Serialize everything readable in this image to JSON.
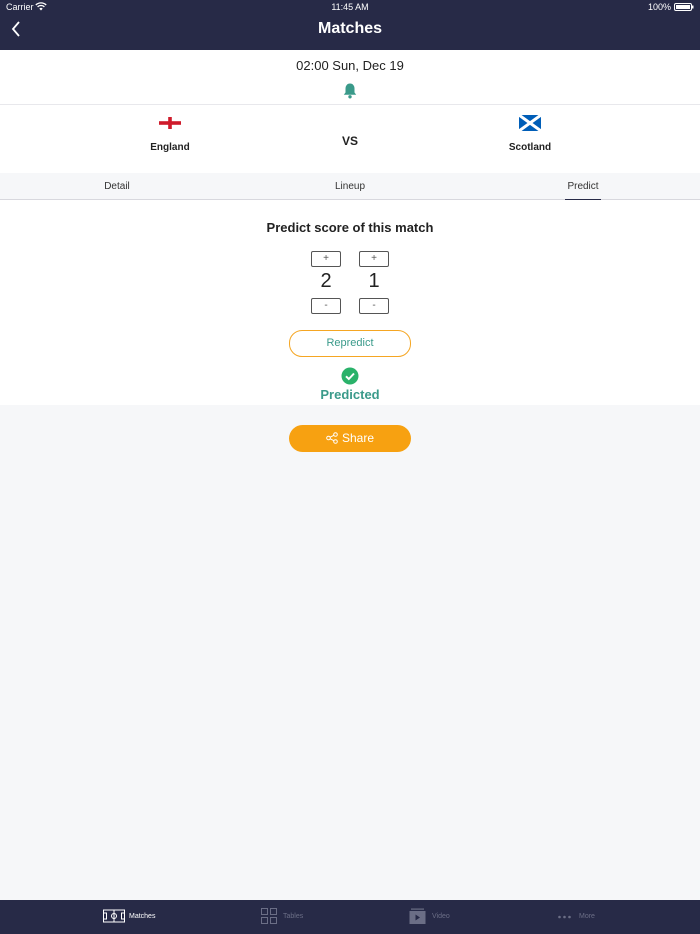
{
  "status_bar": {
    "carrier": "Carrier",
    "time": "11:45 AM",
    "battery": "100%"
  },
  "header": {
    "title": "Matches",
    "back_icon": "chevron-left-icon"
  },
  "match": {
    "datetime": "02:00 Sun, Dec 19",
    "home_team": "England",
    "away_team": "Scotland",
    "vs": "VS"
  },
  "tabs": [
    {
      "label": "Detail"
    },
    {
      "label": "Lineup"
    },
    {
      "label": "Predict",
      "active": true
    }
  ],
  "predict": {
    "title": "Predict score of this match",
    "home_score": "2",
    "away_score": "1",
    "plus": "+",
    "minus": "-",
    "repredict_label": "Repredict",
    "status": "Predicted"
  },
  "share": {
    "label": "Share"
  },
  "tab_bar": {
    "items": [
      {
        "label": "Matches",
        "icon": "pitch-icon",
        "active": true
      },
      {
        "label": "Tables",
        "icon": "grid-icon"
      },
      {
        "label": "Video",
        "icon": "video-icon"
      },
      {
        "label": "More",
        "icon": "more-icon"
      }
    ]
  },
  "colors": {
    "header_bg": "#272a47",
    "accent_orange": "#f7a111",
    "teal": "#3a9a8a",
    "check_green": "#2ab26a"
  }
}
